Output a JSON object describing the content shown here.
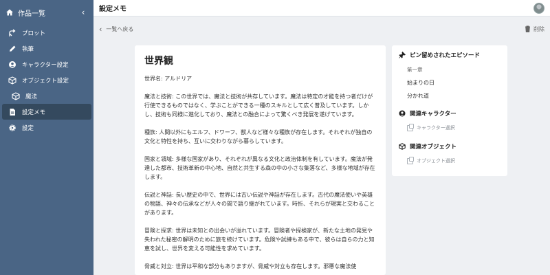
{
  "sidebar": {
    "header_label": "作品一覧",
    "items": [
      {
        "label": "プロット",
        "icon": "plot-icon"
      },
      {
        "label": "執筆",
        "icon": "pen-icon"
      },
      {
        "label": "キャラクター設定",
        "icon": "user-circle-icon"
      },
      {
        "label": "オブジェクト設定",
        "icon": "cube-icon"
      },
      {
        "label": "魔法",
        "icon": "cube-icon"
      },
      {
        "label": "設定メモ",
        "icon": "document-icon"
      },
      {
        "label": "設定",
        "icon": "gear-icon"
      }
    ],
    "active_index": 5
  },
  "header": {
    "title": "設定メモ"
  },
  "subbar": {
    "back_label": "一覧へ戻る",
    "delete_label": "削除"
  },
  "document": {
    "title": "世界観",
    "paragraphs": [
      "世界名: アルドリア",
      "魔法と技術: この世界では、魔法と技術が共存しています。魔法は特定の才能を持つ者だけが行使できるものではなく、学ぶことができる一種のスキルとして広く普及しています。しかし、技術も同様に進化しており、魔法との融合によって驚くべき発展を遂げています。",
      "種族: 人間以外にもエルフ、ドワーフ、獣人など様々な種族が存在します。それぞれが独自の文化と特性を持ち、互いに交わりながら暮らしています。",
      "国家と領域: 多様な国家があり、それぞれが異なる文化と政治体制を有しています。魔法が発達した都市、技術革新の中心地、自然と共生する森の中の小さな集落など、多様な地域が存在します。",
      "伝説と神話: 長い歴史の中で、世界には古い伝説や神話が存在します。古代の魔法使いや英雄の物語、神々の伝承などが人々の間で語り継がれています。時折、それらが現実と交わることがあります。",
      "冒険と探求: 世界は未知との出会いが溢れています。冒険者や探検家が、新たな土地の発見や失われた秘密の解明のために旅を続けています。危険や試練もある中で、彼らは自らの力と知恵を試し、世界を変える可能性を求めています。",
      "脅威と対立: 世界は平和な部分もありますが、脅威や対立も存在します。邪悪な魔法使"
    ]
  },
  "panel": {
    "pinned_title": "ピン留めされたエピソード",
    "episodes": [
      {
        "label": "第一章",
        "dim": true
      },
      {
        "label": "始まりの日",
        "dim": false
      },
      {
        "label": "分かれ道",
        "dim": false
      }
    ],
    "character_title": "関連キャラクター",
    "character_select": "キャラクター選択",
    "object_title": "関連オブジェクト",
    "object_select": "オブジェクト選択"
  },
  "colors": {
    "sidebar_bg": "#4a6585",
    "sidebar_active": "#34495e",
    "page_bg": "#eef0f3"
  }
}
